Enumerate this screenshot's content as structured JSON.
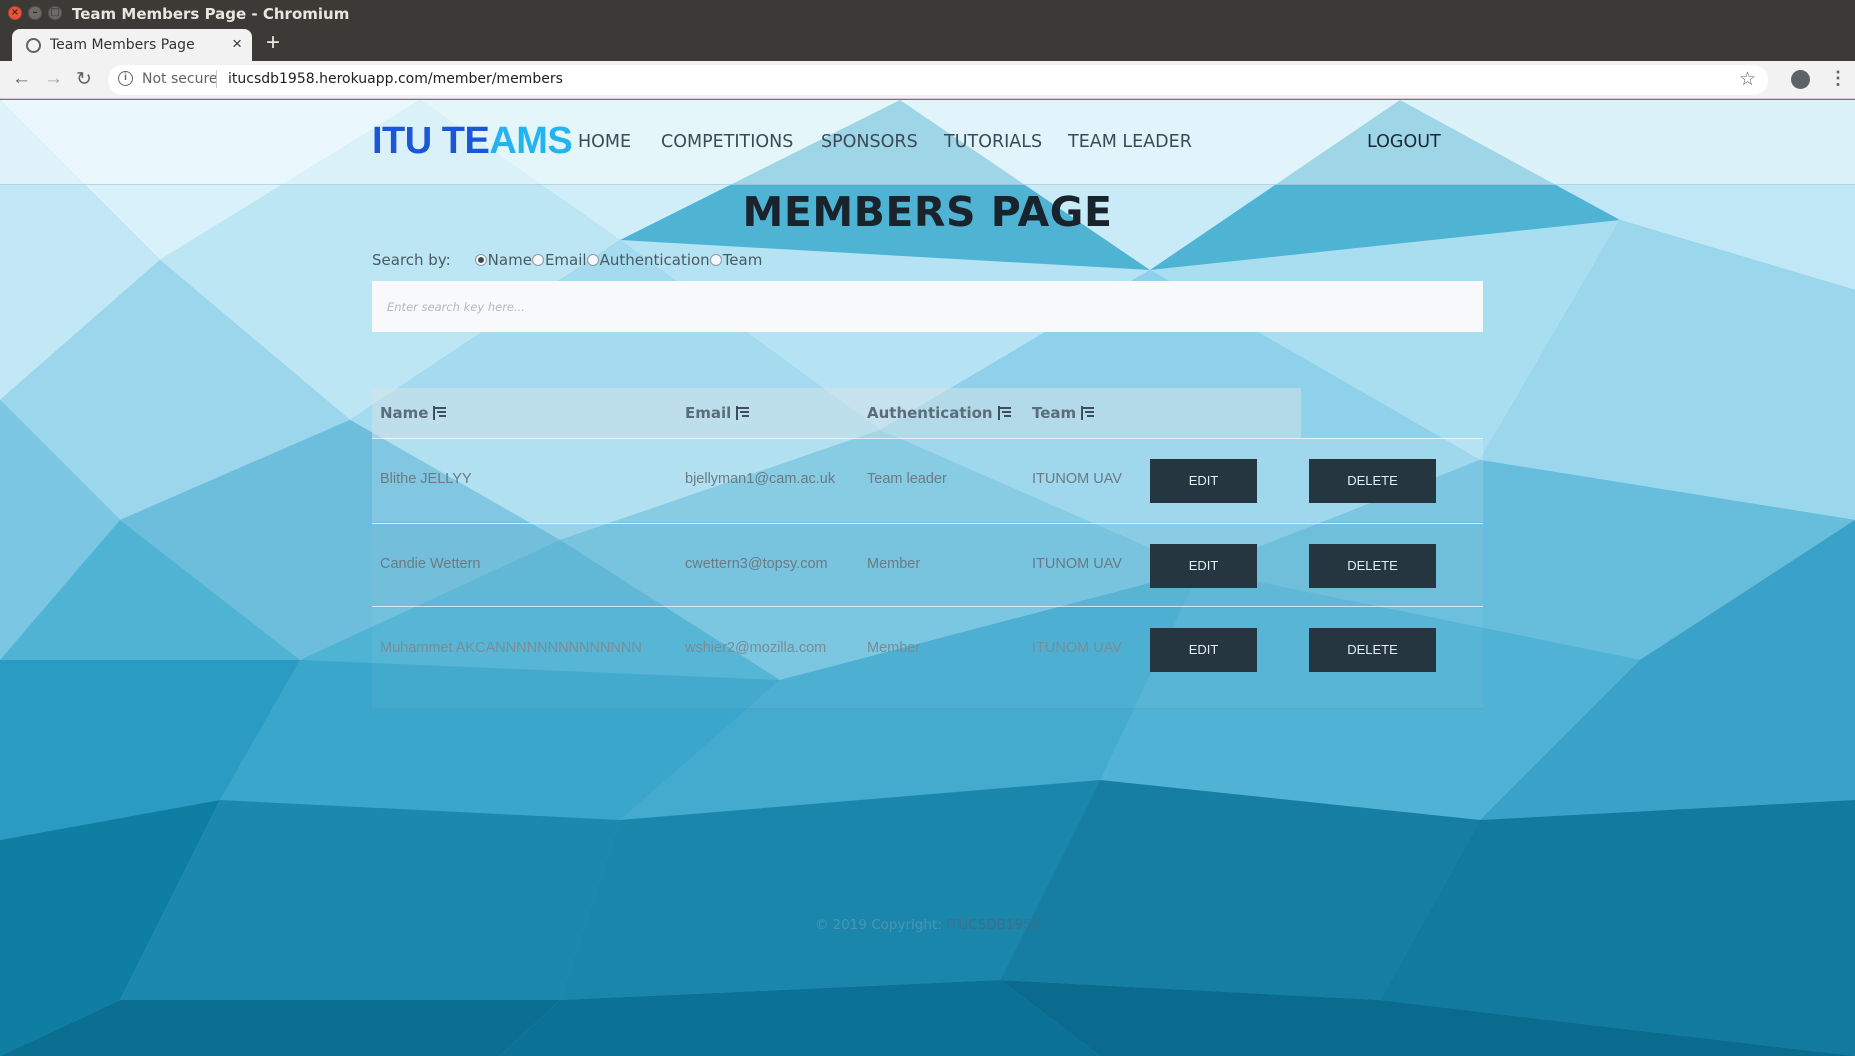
{
  "window": {
    "title": "Team Members Page - Chromium"
  },
  "browser": {
    "tab_title": "Team Members Page",
    "security_label": "Not secure",
    "url": "itucsdb1958.herokuapp.com/member/members"
  },
  "header": {
    "brand_part1": "ITU TE",
    "brand_part2": "AMS",
    "nav": [
      "HOME",
      "COMPETITIONS",
      "SPONSORS",
      "TUTORIALS",
      "TEAM LEADER"
    ],
    "logout": "LOGOUT"
  },
  "page": {
    "title": "MEMBERS PAGE",
    "search_by_label": "Search by:",
    "search_options": [
      "Name",
      "Email",
      "Authentication",
      "Team"
    ],
    "search_selected": "Name",
    "search_placeholder": "Enter search key here..."
  },
  "table": {
    "columns": [
      "Name",
      "Email",
      "Authentication",
      "Team"
    ],
    "edit_label": "EDIT",
    "delete_label": "DELETE",
    "rows": [
      {
        "name": "Blithe JELLYY",
        "email": "bjellyman1@cam.ac.uk",
        "auth": "Team leader",
        "team": "ITUNOM UAV"
      },
      {
        "name": "Candie Wettern",
        "email": "cwettern3@topsy.com",
        "auth": "Member",
        "team": "ITUNOM UAV"
      },
      {
        "name": "Muhammet AKCANNNNNNNNNNNNNN",
        "email": "wshier2@mozilla.com",
        "auth": "Member",
        "team": "ITUNOM UAV"
      }
    ]
  },
  "footer": {
    "prefix": "© 2019 Copyright:",
    "owner": "ITUCSDB1958"
  },
  "colors": {
    "brand_dark": "#1a57d6",
    "brand_light": "#23b4f0",
    "button": "#263640"
  }
}
